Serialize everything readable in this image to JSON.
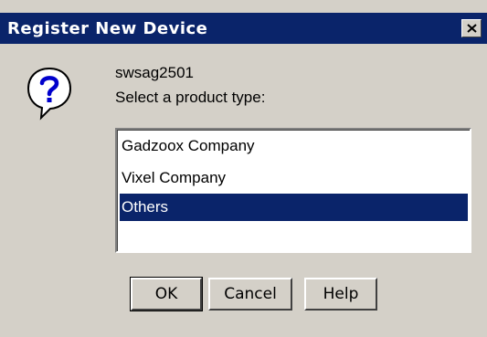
{
  "window": {
    "title": "Register New Device"
  },
  "icons": {
    "close": "close-icon",
    "question": "question-icon"
  },
  "content": {
    "device_name": "swsag2501",
    "prompt": "Select a product type:"
  },
  "product_types": [
    {
      "label": "Gadzoox Company",
      "selected": false
    },
    {
      "label": "Vixel Company",
      "selected": false
    },
    {
      "label": "Others",
      "selected": true
    }
  ],
  "buttons": {
    "ok": "OK",
    "cancel": "Cancel",
    "help": "Help"
  },
  "colors": {
    "titlebar": "#0a246a",
    "face": "#d4d0c8",
    "selection": "#0a246a"
  }
}
